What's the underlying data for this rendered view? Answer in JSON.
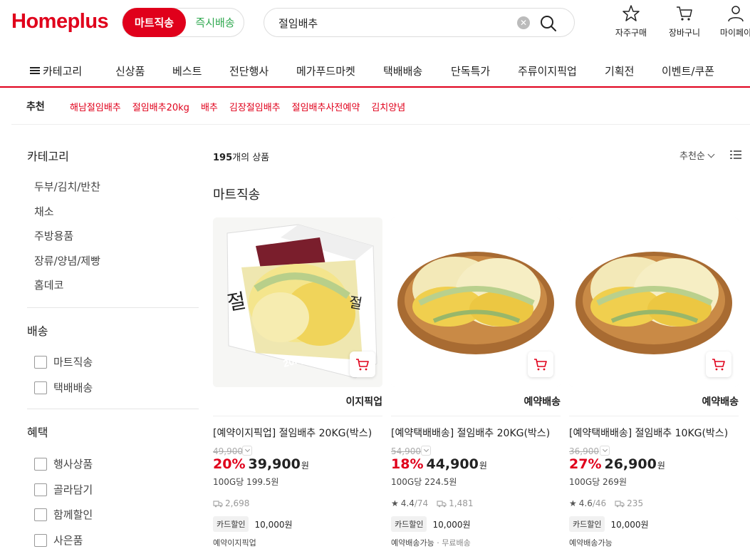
{
  "header": {
    "logo": "Homeplus",
    "mode_active": "마트직송",
    "mode_inactive": "즉시배송",
    "search_value": "절임배추",
    "utilities": [
      {
        "label": "자주구매",
        "icon": "star-icon"
      },
      {
        "label": "장바구니",
        "icon": "cart-icon"
      },
      {
        "label": "마이페이",
        "icon": "user-icon"
      }
    ]
  },
  "nav": {
    "category_label": "카테고리",
    "items": [
      "신상품",
      "베스트",
      "전단행사",
      "메가푸드마켓",
      "택배배송",
      "단독특가",
      "주류이지픽업",
      "기획전",
      "이벤트/쿠폰"
    ]
  },
  "recommend": {
    "title": "추천",
    "keywords": [
      "해남절임배추",
      "절임배추20kg",
      "배추",
      "김장절임배추",
      "절임배추사전예약",
      "김치양념"
    ]
  },
  "sidebar": {
    "category_title": "카테고리",
    "categories": [
      "두부/김치/반찬",
      "채소",
      "주방용품",
      "장류/양념/제빵",
      "홈데코"
    ],
    "delivery_title": "배송",
    "delivery_options": [
      "마트직송",
      "택배배송"
    ],
    "benefit_title": "혜택",
    "benefit_options": [
      "행사상품",
      "골라담기",
      "함께할인",
      "사은품"
    ]
  },
  "main": {
    "count_num": "195",
    "count_suffix": "개의 상품",
    "sort_label": "추천순",
    "section_title": "마트직송"
  },
  "products": [
    {
      "tag": "이지픽업",
      "name": "[예약이지픽업] 절임배추 20KG(박스)",
      "original_price": "49,900",
      "discount_rate": "20%",
      "price": "39,900",
      "won": "원",
      "unit_price": "100G당 199.5원",
      "rating": "",
      "review_count": "",
      "purchase_count": "2,698",
      "benefit_badge": "카드할인",
      "benefit_value": "10,000원",
      "delivery_info": "예약이지픽업",
      "delivery_extra": "",
      "image": "box"
    },
    {
      "tag": "예약배송",
      "name": "[예약택배배송] 절임배추 20KG(박스)",
      "original_price": "54,900",
      "discount_rate": "18%",
      "price": "44,900",
      "won": "원",
      "unit_price": "100G당 224.5원",
      "rating": "4.4",
      "review_count": "/74",
      "purchase_count": "1,481",
      "benefit_badge": "카드할인",
      "benefit_value": "10,000원",
      "delivery_info": "예약배송가능",
      "delivery_extra": " · 무료배송",
      "image": "basket"
    },
    {
      "tag": "예약배송",
      "name": "[예약택배배송] 절임배추 10KG(박스)",
      "original_price": "36,900",
      "discount_rate": "27%",
      "price": "26,900",
      "won": "원",
      "unit_price": "100G당 269원",
      "rating": "4.6",
      "review_count": "/46",
      "purchase_count": "235",
      "benefit_badge": "카드할인",
      "benefit_value": "10,000원",
      "delivery_info": "예약배송가능",
      "delivery_extra": "",
      "image": "basket"
    }
  ],
  "colors": {
    "brand": "#e0001b",
    "instant": "#2fa84f"
  }
}
